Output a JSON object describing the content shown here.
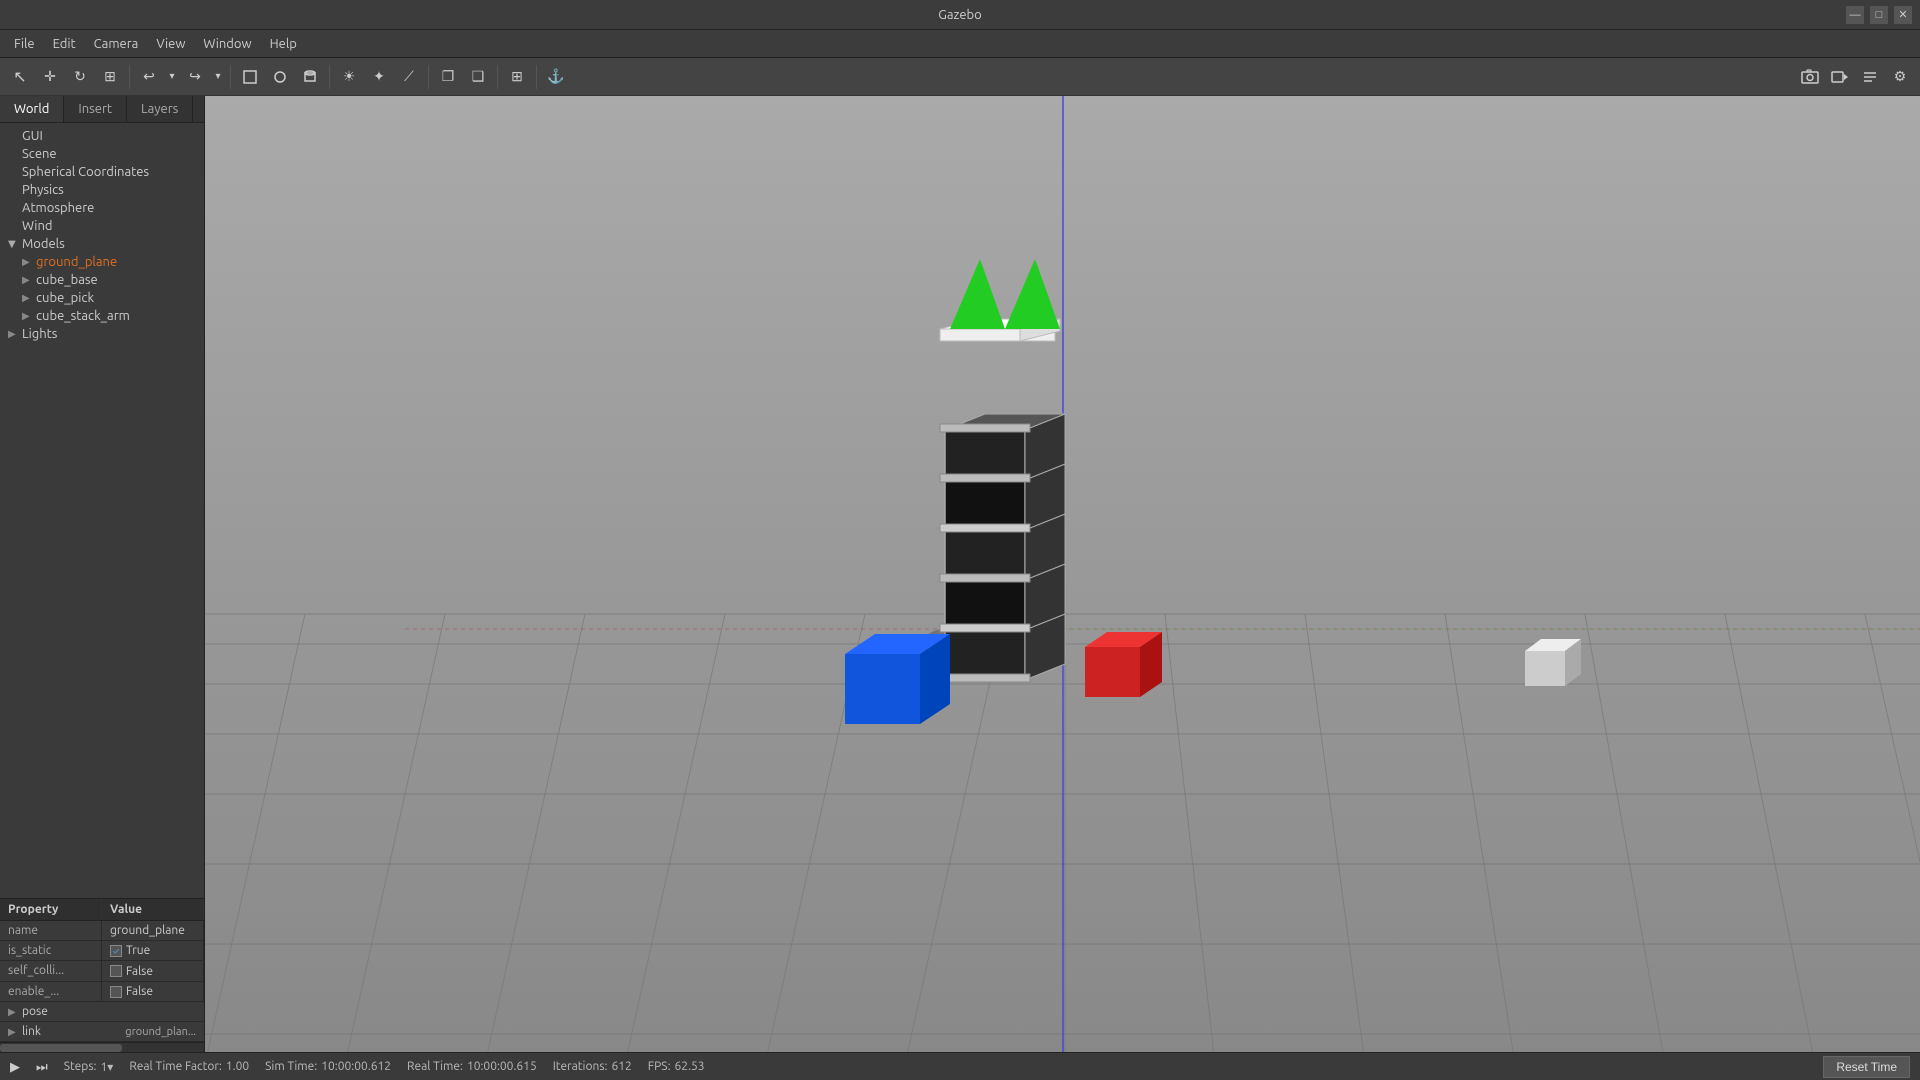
{
  "window": {
    "title": "Gazebo"
  },
  "titlebar": {
    "title": "Gazebo",
    "controls": [
      "—",
      "□",
      "✕"
    ]
  },
  "menubar": {
    "items": [
      "File",
      "Edit",
      "Camera",
      "View",
      "Window",
      "Help"
    ]
  },
  "toolbar": {
    "tools": [
      {
        "name": "select-tool",
        "icon": "↖",
        "tooltip": "Select"
      },
      {
        "name": "translate-tool",
        "icon": "✛",
        "tooltip": "Translate"
      },
      {
        "name": "rotate-tool",
        "icon": "↻",
        "tooltip": "Rotate"
      },
      {
        "name": "scale-tool",
        "icon": "⊞",
        "tooltip": "Scale"
      },
      {
        "name": "undo-btn",
        "icon": "↩",
        "tooltip": "Undo"
      },
      {
        "name": "redo-btn",
        "icon": "↪",
        "tooltip": "Redo"
      },
      {
        "name": "box-shape",
        "icon": "□",
        "tooltip": "Box"
      },
      {
        "name": "sphere-shape",
        "icon": "○",
        "tooltip": "Sphere"
      },
      {
        "name": "cylinder-shape",
        "icon": "⬛",
        "tooltip": "Cylinder"
      },
      {
        "name": "sun-light",
        "icon": "☀",
        "tooltip": "Sun"
      },
      {
        "name": "point-light",
        "icon": "✦",
        "tooltip": "Point"
      },
      {
        "name": "spot-light",
        "icon": "/",
        "tooltip": "Spot"
      },
      {
        "name": "copy-btn",
        "icon": "❐",
        "tooltip": "Copy"
      },
      {
        "name": "paste-btn",
        "icon": "❑",
        "tooltip": "Paste"
      },
      {
        "name": "align-btn",
        "icon": "⊞",
        "tooltip": "Align"
      },
      {
        "name": "snap-btn",
        "icon": "⚓",
        "tooltip": "Snap"
      },
      {
        "name": "screenshot-btn",
        "icon": "📷",
        "tooltip": "Screenshot"
      }
    ]
  },
  "left_panel": {
    "tabs": [
      "World",
      "Insert",
      "Layers"
    ],
    "active_tab": "World",
    "tree": {
      "items": [
        {
          "id": "gui",
          "label": "GUI",
          "indent": 0,
          "has_arrow": false,
          "expanded": false
        },
        {
          "id": "scene",
          "label": "Scene",
          "indent": 0,
          "has_arrow": false,
          "expanded": false
        },
        {
          "id": "spherical_coords",
          "label": "Spherical Coordinates",
          "indent": 0,
          "has_arrow": false,
          "expanded": false
        },
        {
          "id": "physics",
          "label": "Physics",
          "indent": 0,
          "has_arrow": false,
          "expanded": false
        },
        {
          "id": "atmosphere",
          "label": "Atmosphere",
          "indent": 0,
          "has_arrow": false,
          "expanded": false
        },
        {
          "id": "wind",
          "label": "Wind",
          "indent": 0,
          "has_arrow": false,
          "expanded": false
        },
        {
          "id": "models",
          "label": "Models",
          "indent": 0,
          "has_arrow": true,
          "expanded": true
        },
        {
          "id": "ground_plane",
          "label": "ground_plane",
          "indent": 1,
          "has_arrow": true,
          "expanded": false,
          "selected": true
        },
        {
          "id": "cube_base",
          "label": "cube_base",
          "indent": 1,
          "has_arrow": true,
          "expanded": false
        },
        {
          "id": "cube_pick",
          "label": "cube_pick",
          "indent": 1,
          "has_arrow": true,
          "expanded": false
        },
        {
          "id": "cube_stack_arm",
          "label": "cube_stack_arm",
          "indent": 1,
          "has_arrow": true,
          "expanded": false
        },
        {
          "id": "lights",
          "label": "Lights",
          "indent": 0,
          "has_arrow": true,
          "expanded": false
        }
      ]
    },
    "properties": {
      "header": [
        "Property",
        "Value"
      ],
      "rows": [
        {
          "type": "plain",
          "property": "name",
          "value": "ground_plane"
        },
        {
          "type": "checkbox",
          "property": "is_static",
          "value": "True",
          "checked": true
        },
        {
          "type": "checkbox",
          "property": "self_colli...",
          "value": "False",
          "checked": false
        },
        {
          "type": "checkbox",
          "property": "enable_...",
          "value": "False",
          "checked": false
        },
        {
          "type": "expandable",
          "property": "pose",
          "value": ""
        },
        {
          "type": "expandable",
          "property": "link",
          "value": "ground_plan..."
        }
      ]
    }
  },
  "statusbar": {
    "steps_label": "Steps:",
    "steps_value": "1",
    "real_time_factor_label": "Real Time Factor:",
    "real_time_factor_value": "1.00",
    "sim_time_label": "Sim Time:",
    "sim_time_value": "10:00:00.612",
    "real_time_label": "Real Time:",
    "real_time_value": "10:00:00.615",
    "iterations_label": "Iterations:",
    "iterations_value": "612",
    "fps_label": "FPS:",
    "fps_value": "62.53",
    "reset_time_label": "Reset Time"
  }
}
